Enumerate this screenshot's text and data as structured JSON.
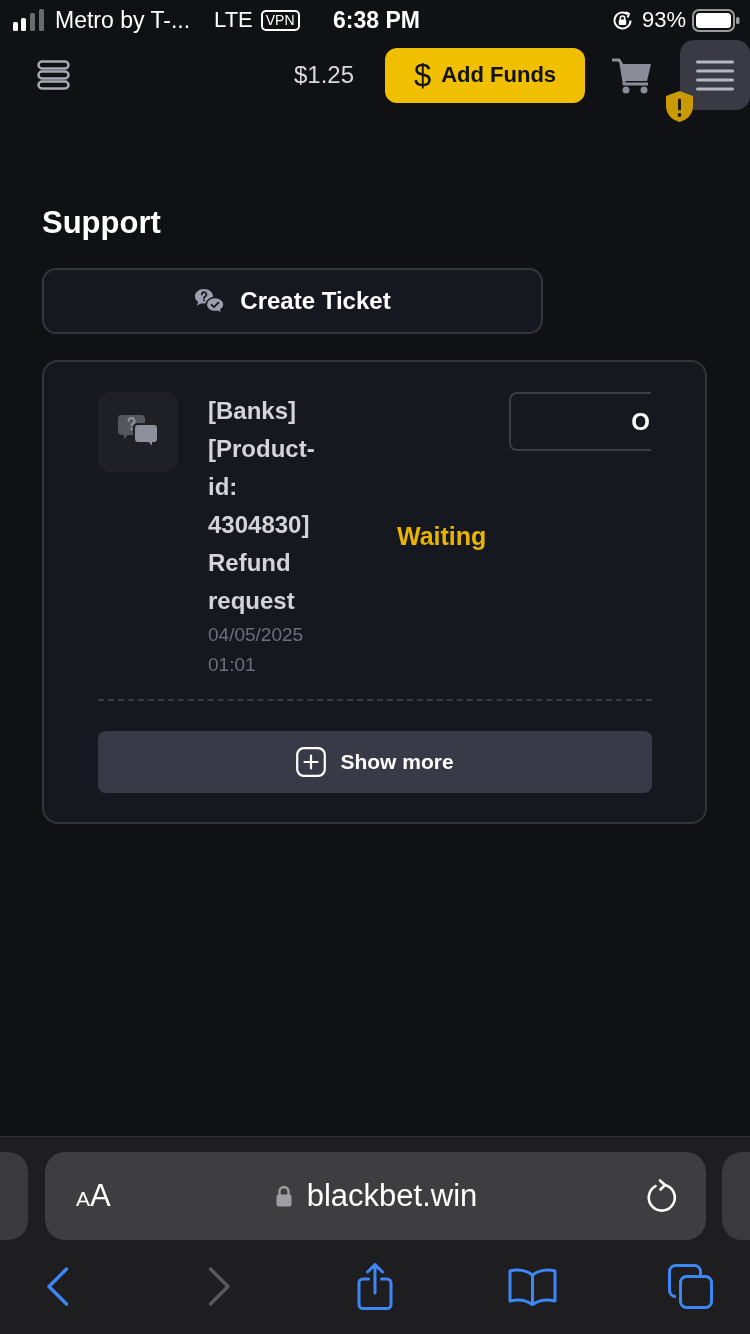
{
  "status_bar": {
    "carrier": "Metro by T-...",
    "network": "LTE",
    "vpn": "VPN",
    "time": "6:38 PM",
    "battery": "93%"
  },
  "header": {
    "balance": "$1.25",
    "add_funds": {
      "icon": "$",
      "label": "Add Funds"
    }
  },
  "support": {
    "title": "Support",
    "create_button": "Create Ticket",
    "tickets": [
      {
        "title": "[Banks] [Product-id: 4304830] Refund request",
        "date": "04/05/2025 01:01",
        "status": "Waiting",
        "color": "#e8b400",
        "action": "O"
      }
    ],
    "show_more": "Show more"
  },
  "browser": {
    "text_size_button": {
      "small": "A",
      "large": "A"
    },
    "url": "blackbet.win",
    "back": {
      "disabled": false
    },
    "forward": {
      "disabled": true
    }
  }
}
